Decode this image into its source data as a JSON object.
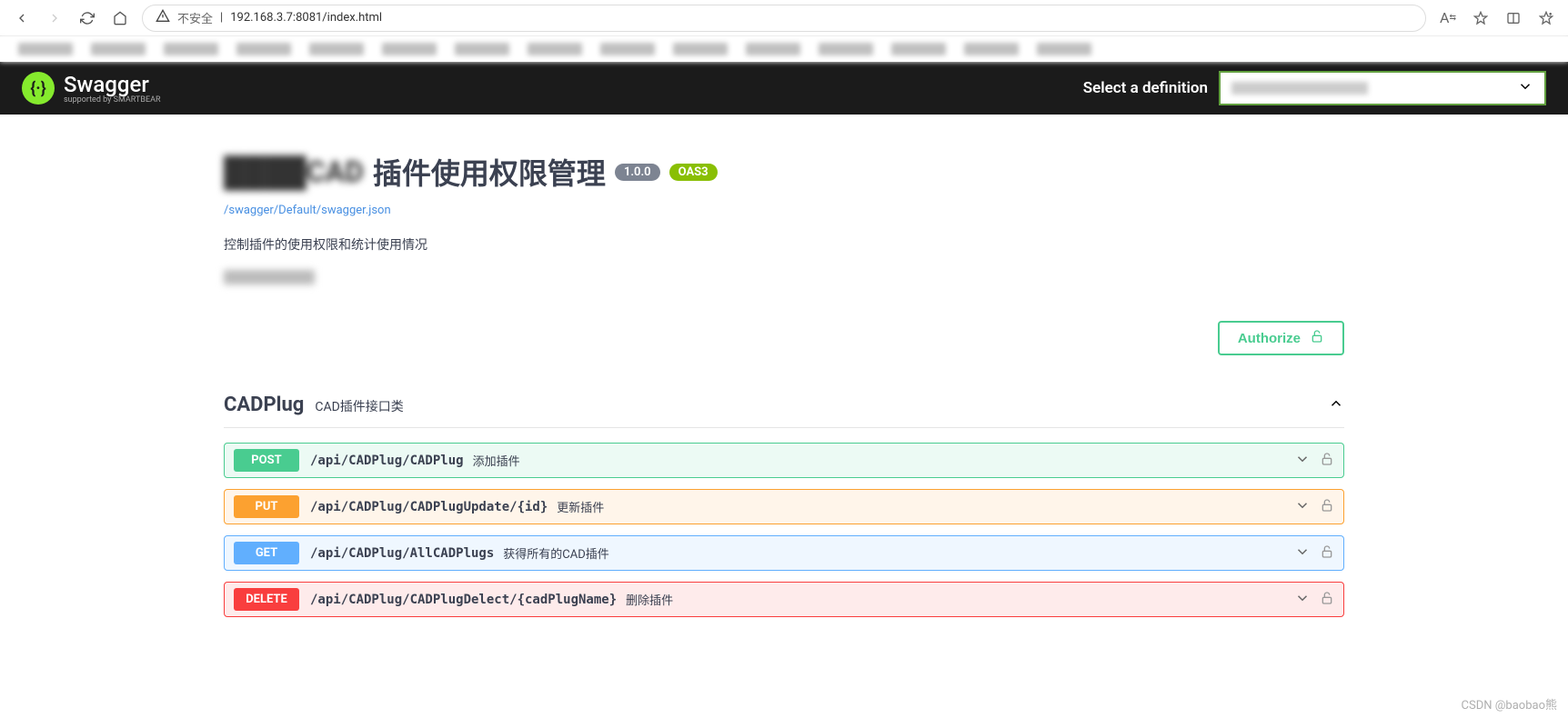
{
  "browser": {
    "security": "不安全",
    "url": "192.168.3.7:8081/index.html"
  },
  "header": {
    "brand": "Swagger",
    "brand_sub": "supported by SMARTBEAR",
    "definition_label": "Select a definition"
  },
  "api": {
    "title_prefix_blur": "████CAD",
    "title": "插件使用权限管理",
    "version": "1.0.0",
    "oas": "OAS3",
    "json_link": "/swagger/Default/swagger.json",
    "description": "控制插件的使用权限和统计使用情况",
    "authorize_label": "Authorize"
  },
  "section": {
    "name": "CADPlug",
    "desc": "CAD插件接口类"
  },
  "endpoints": [
    {
      "method": "POST",
      "cls": "post",
      "path": "/api/CADPlug/CADPlug",
      "desc": "添加插件"
    },
    {
      "method": "PUT",
      "cls": "put",
      "path": "/api/CADPlug/CADPlugUpdate/{id}",
      "desc": "更新插件"
    },
    {
      "method": "GET",
      "cls": "get",
      "path": "/api/CADPlug/AllCADPlugs",
      "desc": "获得所有的CAD插件"
    },
    {
      "method": "DELETE",
      "cls": "delete",
      "path": "/api/CADPlug/CADPlugDelect/{cadPlugName}",
      "desc": "删除插件"
    }
  ],
  "watermark": "CSDN @baobao熊"
}
